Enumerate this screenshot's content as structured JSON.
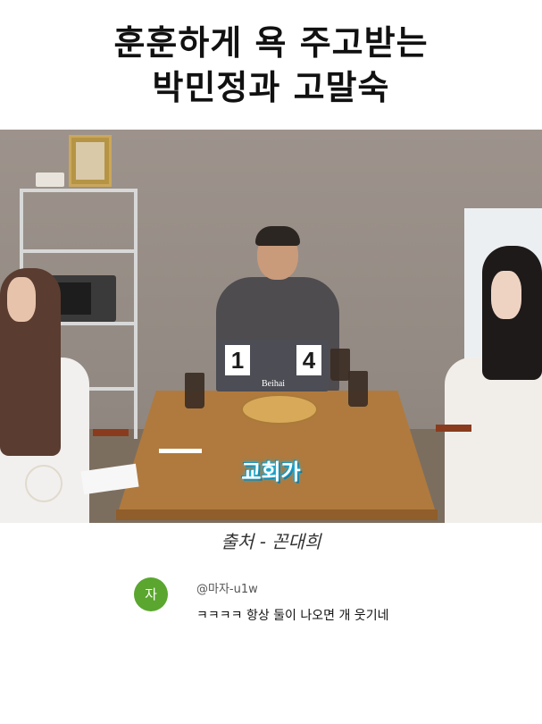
{
  "title": {
    "line1": "훈훈하게 욕 주고받는",
    "line2": "박민정과 고말숙"
  },
  "video": {
    "scoreboard": {
      "left_card": "1",
      "right_card": "4",
      "brand": "Beihai"
    },
    "subtitle": "교회가"
  },
  "source": "출처 - 꼰대희",
  "comment": {
    "avatar_letter": "자",
    "avatar_color": "#5aa62f",
    "handle": "@마자-u1w",
    "text": "ㅋㅋㅋㅋ 항상 둘이 나오면 개 웃기네"
  }
}
